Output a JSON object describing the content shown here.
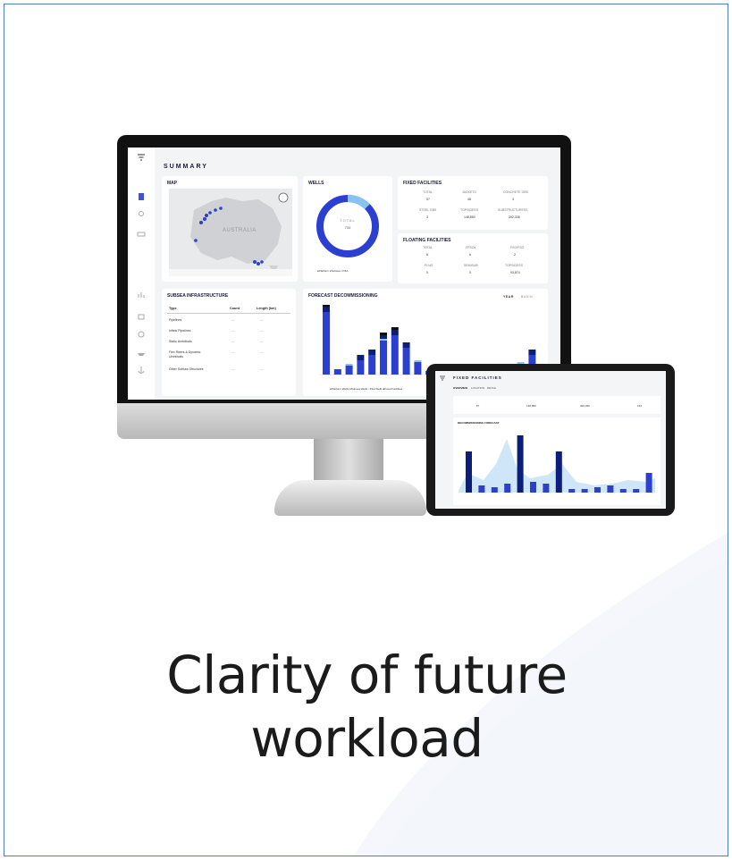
{
  "caption": {
    "line1": "Clarity of future",
    "line2": "workload"
  },
  "colors": {
    "border": "#4a7fc1",
    "navy": "#0c1e7a",
    "royal": "#2b3fd0",
    "sky": "#86c4ef",
    "black": "#0c0c0c"
  },
  "monitor": {
    "screen_title": "SUMMARY",
    "sidebar_icons": [
      "filter-icon",
      "document-icon",
      "location-icon",
      "truck-icon",
      "chart-icon",
      "platform-icon",
      "settings-icon",
      "vessel-icon",
      "anchor-icon"
    ],
    "map": {
      "title": "MAP",
      "country_label": "AUSTRALIA"
    },
    "wells": {
      "title": "WELLS",
      "center_label": "TOTAL",
      "center_value": "734",
      "legend": [
        "Platform",
        "Subsea",
        "P&A"
      ]
    },
    "fixed": {
      "title": "FIXED FACILITIES",
      "row1_labels": [
        "TOTAL",
        "JACKETS",
        "CONCRETE GBS"
      ],
      "row1_values": [
        "57",
        "48",
        "3"
      ],
      "row2_labels": [
        "STEEL GBS",
        "TOPSIDESS",
        "SUBSTRUCTURESS"
      ],
      "row2_values": [
        "3",
        "148,850",
        "392,336"
      ]
    },
    "floating": {
      "title": "FLOATING FACILITIES",
      "row1_labels": [
        "TOTAL",
        "FPSOs",
        "FSO/FSO"
      ],
      "row1_values": [
        "8",
        "6",
        "2"
      ],
      "row2_labels": [
        "FLNG",
        "SEMISUB",
        "TOPSIDESS"
      ],
      "row2_values": [
        "0",
        "0",
        "93,874"
      ]
    },
    "subsea": {
      "title": "SUBSEA INFRASTRUCTURE",
      "headers": [
        "Type",
        "Count",
        "Length (km)"
      ],
      "rows": [
        [
          "Pipelines",
          "—",
          "—"
        ],
        [
          "Infield Pipelines",
          "—",
          "—"
        ],
        [
          "Static Umbilicals",
          "—",
          "—"
        ],
        [
          "Flex Risers & Dynamic Umbilicals",
          "—",
          "—"
        ],
        [
          "Other Subsea Structures",
          "—",
          "—"
        ]
      ]
    },
    "forecast": {
      "title": "FORECAST DECOMMISSIONING",
      "buttons": [
        "YEAR",
        "BASIN"
      ],
      "legend": [
        "Platform Wells",
        "Subsea Wells",
        "P&A Wells",
        "Fixed Facilities"
      ]
    }
  },
  "tablet": {
    "title": "FIXED FACILITIES",
    "tabs": [
      "OVERVIEW",
      "LOCATION",
      "DETAIL"
    ],
    "stats": [
      "57",
      "148,850",
      "392,336",
      "154"
    ],
    "chart_title": "DECOMMISSIONING FORECAST"
  }
}
